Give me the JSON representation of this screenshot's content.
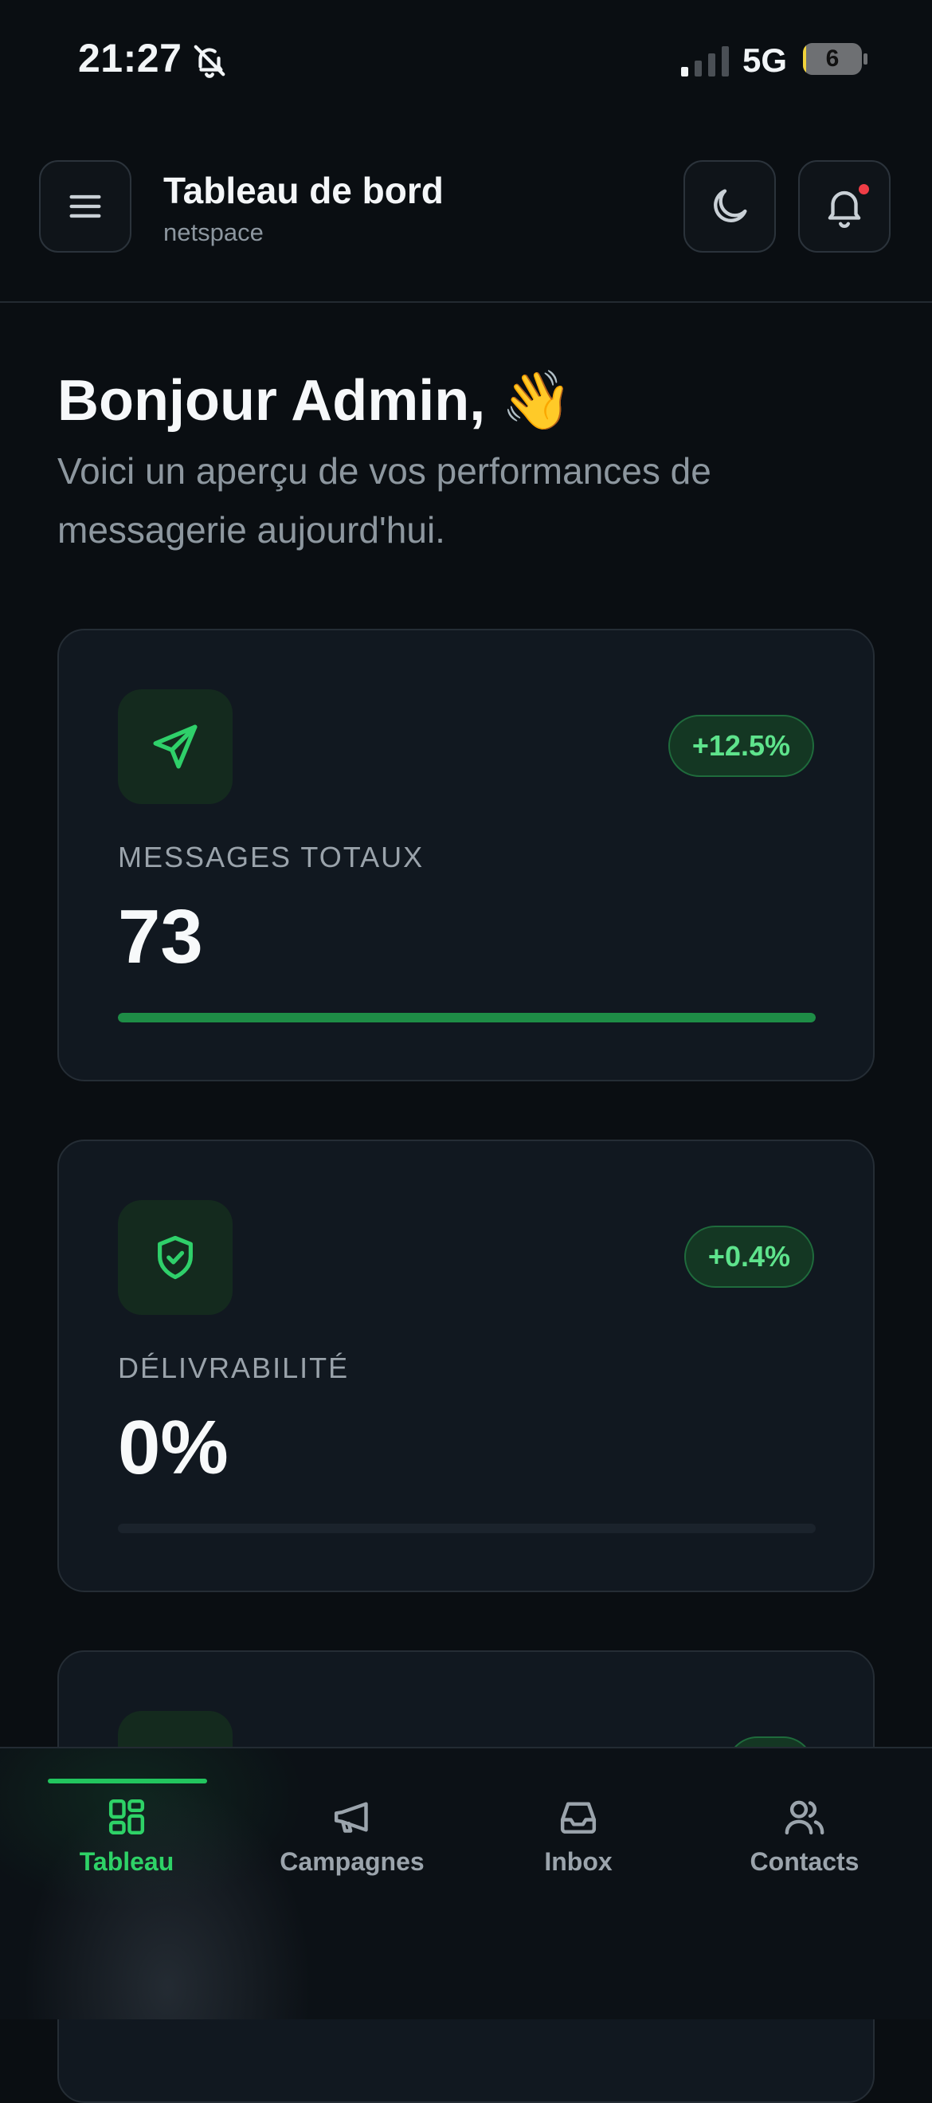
{
  "status_bar": {
    "time": "21:27",
    "network": "5G",
    "battery_level": "6",
    "battery_fraction": 0.06
  },
  "header": {
    "title": "Tableau de bord",
    "subtitle": "netspace",
    "has_notification": true
  },
  "greeting": {
    "title": "Bonjour Admin,",
    "emoji": "👋",
    "subtitle": "Voici un aperçu de vos performances de messagerie aujourd'hui."
  },
  "stats": [
    {
      "label": "MESSAGES TOTAUX",
      "value": "73",
      "change": "+12.5%",
      "icon": "send-icon",
      "progress": 1.0
    },
    {
      "label": "DÉLIVRABILITÉ",
      "value": "0%",
      "change": "+0.4%",
      "icon": "shield-check-icon",
      "progress": 0.0
    },
    {
      "label": "",
      "value": "",
      "change": "",
      "icon": "unknown-icon"
    }
  ],
  "bottom_nav": {
    "items": [
      {
        "label": "Tableau",
        "icon": "grid-icon",
        "active": true
      },
      {
        "label": "Campagnes",
        "icon": "megaphone-icon",
        "active": false
      },
      {
        "label": "Inbox",
        "icon": "inbox-icon",
        "active": false
      },
      {
        "label": "Contacts",
        "icon": "users-icon",
        "active": false
      }
    ]
  },
  "colors": {
    "accent": "#22c55e",
    "background": "#0a0e12",
    "card": "#111820",
    "notification": "#ef3d46"
  }
}
